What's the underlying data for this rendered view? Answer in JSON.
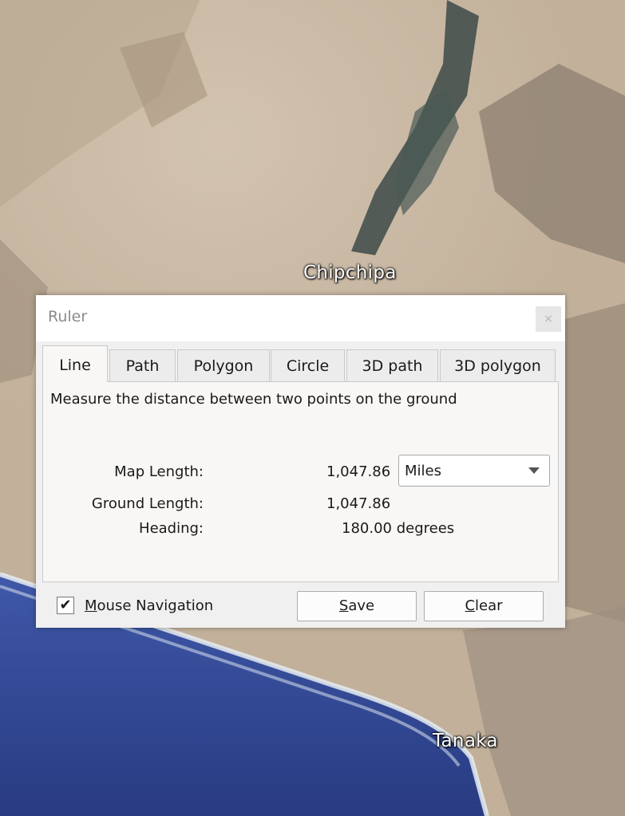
{
  "map": {
    "labels": {
      "chipchipa": "Chipchipa",
      "tanaka": "Tanaka"
    },
    "colors": {
      "desert": "#c2b09a",
      "sand_light": "#d9cbb8",
      "terrain_dark": "#8c7f70",
      "vegetation": "#3d4a48",
      "ocean_deep": "#283b82",
      "ocean_mid": "#3f58a8",
      "surf": "#e6edf2"
    }
  },
  "ruler": {
    "title": "Ruler",
    "close_glyph": "×",
    "tabs": [
      "Line",
      "Path",
      "Polygon",
      "Circle",
      "3D path",
      "3D polygon"
    ],
    "active_tab": "Line",
    "description": "Measure the distance between two points on the ground",
    "map_length": {
      "label": "Map Length:",
      "value": "1,047.86"
    },
    "unit": {
      "selected": "Miles"
    },
    "ground_length": {
      "label": "Ground Length:",
      "value": "1,047.86"
    },
    "heading": {
      "label": "Heading:",
      "value": "180.00 degrees"
    },
    "mouse_navigation": {
      "checked": true,
      "check_glyph": "✔",
      "label_mnemonic": "M",
      "label_rest": "ouse Navigation"
    },
    "save_button": {
      "mnemonic": "S",
      "rest": "ave"
    },
    "clear_button": {
      "mnemonic": "C",
      "rest": "lear"
    }
  }
}
